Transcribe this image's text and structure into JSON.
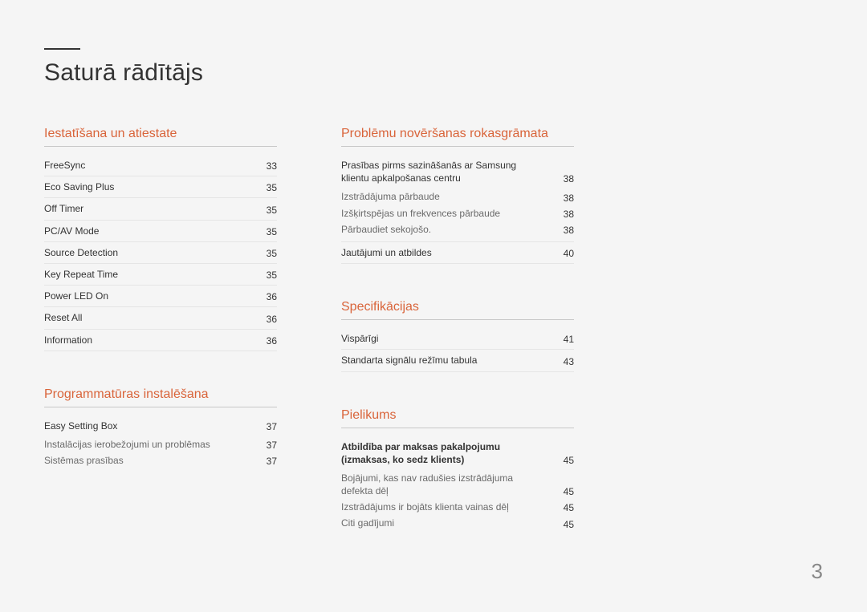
{
  "pageTitle": "Saturā rādītājs",
  "pageNumber": "3",
  "leftColumn": [
    {
      "title": "Iestatīšana un atiestate",
      "entries": [
        {
          "label": "FreeSync",
          "page": "33",
          "type": "main"
        },
        {
          "label": "Eco Saving Plus",
          "page": "35",
          "type": "main"
        },
        {
          "label": "Off Timer",
          "page": "35",
          "type": "main"
        },
        {
          "label": "PC/AV Mode",
          "page": "35",
          "type": "main"
        },
        {
          "label": "Source Detection",
          "page": "35",
          "type": "main"
        },
        {
          "label": "Key Repeat Time",
          "page": "35",
          "type": "main"
        },
        {
          "label": "Power LED On",
          "page": "36",
          "type": "main"
        },
        {
          "label": "Reset All",
          "page": "36",
          "type": "main"
        },
        {
          "label": "Information",
          "page": "36",
          "type": "main"
        }
      ]
    },
    {
      "title": "Programmatūras instalēšana",
      "entries": [
        {
          "label": "Easy Setting Box",
          "page": "37",
          "type": "main-noborder"
        },
        {
          "label": "Instalācijas ierobežojumi un problēmas",
          "page": "37",
          "type": "sub"
        },
        {
          "label": "Sistēmas prasības",
          "page": "37",
          "type": "sub"
        }
      ]
    }
  ],
  "rightColumn": [
    {
      "title": "Problēmu novēršanas rokasgrāmata",
      "entries": [
        {
          "label": "Prasības pirms sazināšanās ar Samsung klientu apkalpošanas centru",
          "page": "38",
          "type": "main-noborder"
        },
        {
          "label": "Izstrādājuma pārbaude",
          "page": "38",
          "type": "sub"
        },
        {
          "label": "Izšķirtspējas un frekvences pārbaude",
          "page": "38",
          "type": "sub"
        },
        {
          "label": "Pārbaudiet sekojošo.",
          "page": "38",
          "type": "sub-close"
        },
        {
          "label": "Jautājumi un atbildes",
          "page": "40",
          "type": "main"
        }
      ]
    },
    {
      "title": "Specifikācijas",
      "entries": [
        {
          "label": "Vispārīgi",
          "page": "41",
          "type": "main"
        },
        {
          "label": "Standarta signālu režīmu tabula",
          "page": "43",
          "type": "main"
        }
      ]
    },
    {
      "title": "Pielikums",
      "entries": [
        {
          "label": "Atbildība par maksas pakalpojumu (izmaksas, ko sedz klients)",
          "page": "45",
          "type": "main-bold-noborder"
        },
        {
          "label": "Bojājumi, kas nav radušies izstrādājuma defekta dēļ",
          "page": "45",
          "type": "sub"
        },
        {
          "label": "Izstrādājums ir bojāts klienta vainas dēļ",
          "page": "45",
          "type": "sub"
        },
        {
          "label": "Citi gadījumi",
          "page": "45",
          "type": "sub"
        }
      ]
    }
  ]
}
